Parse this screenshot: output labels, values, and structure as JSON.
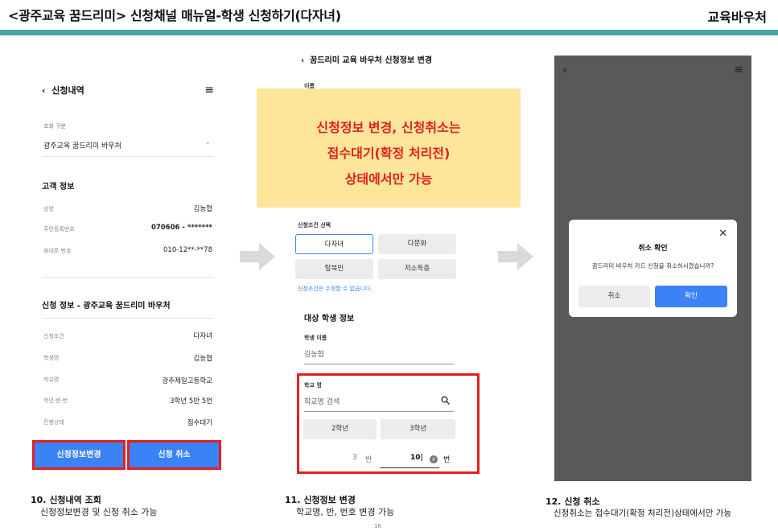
{
  "header": {
    "title": "<광주교육 꿈드리미> 신청채널 매뉴얼-학생 신청하기(다자녀)",
    "tag": "교육바우처",
    "bar_color": "#4aa6a7"
  },
  "screen1": {
    "nav_title": "신청내역",
    "menu_icon": "hamburger-icon",
    "query_label": "조회 구분",
    "query_value": "광주교육 꿈드리미 바우처",
    "customer_section": "고객 정보",
    "customer_rows": [
      {
        "label": "성명",
        "value": "김농협"
      },
      {
        "label": "주민등록번호",
        "value": "070606 -     *******"
      },
      {
        "label": "휴대폰 번호",
        "value": "010-12**-**78"
      }
    ],
    "apply_section": "신청 정보 - 광주교육 꿈드리미 바우처",
    "apply_rows": [
      {
        "label": "신청조건",
        "value": "다자녀"
      },
      {
        "label": "학생명",
        "value": "김농협"
      },
      {
        "label": "학교명",
        "value": "광주제일고등학교"
      },
      {
        "label": "학년·반·번",
        "value": "3학년 5반 5번"
      },
      {
        "label": "진행상태",
        "value": "접수대기"
      }
    ],
    "btn_change": "신청정보변경",
    "btn_cancel": "신청 취소"
  },
  "screen2": {
    "nav_title": "꿈드리미 교육 바우처 신청정보 변경",
    "name_label": "이름",
    "condition_label": "신청조건 선택",
    "chips": [
      "다자녀",
      "다문화",
      "탈북민",
      "저소득층"
    ],
    "selected_chip": "다자녀",
    "condition_note": "신청조건은 수정할 수 없습니다.",
    "student_section": "대상 학생 정보",
    "student_name_label": "학생 이름",
    "student_name_value": "김농협",
    "school_label": "학교 명",
    "school_placeholder": "학교명 검색",
    "grade_chips": [
      "2학년",
      "3학년"
    ],
    "class_value": "3",
    "class_unit": "반",
    "number_value": "10",
    "number_unit": "번"
  },
  "notice": {
    "line1": "신청정보 변경, 신청취소는",
    "line2": "접수대기(확정 처리전)",
    "line3": "상태에서만 가능"
  },
  "screen3": {
    "dialog_title": "취소 확인",
    "dialog_message": "꿈드리미 바우처 카드 신청을 취소하시겠습니까?",
    "btn_cancel": "취소",
    "btn_confirm": "확인"
  },
  "captions": [
    {
      "title": "10. 신청내역 조회",
      "sub": "신청정보변경 및 신청 취소 가능"
    },
    {
      "title": "11. 신청정보 변경",
      "sub": "학교명, 반, 번호 변경 가능"
    },
    {
      "title": "12. 신청 취소",
      "sub": "신청취소는 접수대기(확정 처리전)상태에서만 가능"
    }
  ],
  "page_number": "16",
  "colors": {
    "accent": "#3b82f6",
    "highlight": "#e02020",
    "notice_bg": "#fde69a"
  }
}
